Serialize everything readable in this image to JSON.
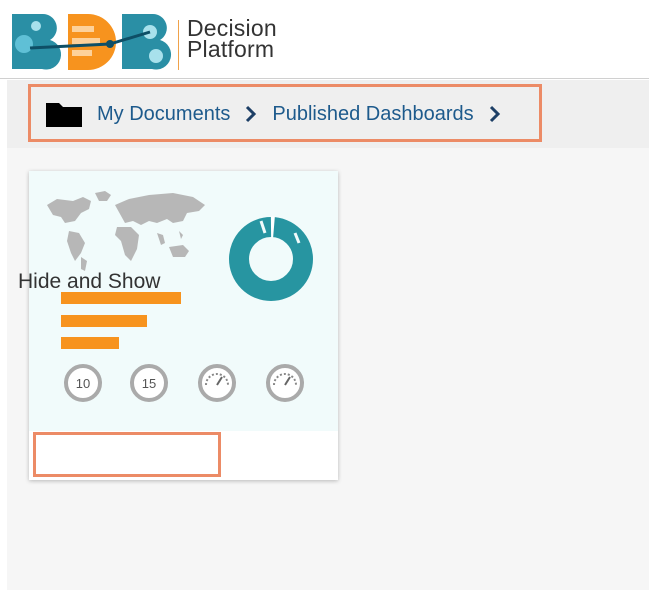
{
  "brand": {
    "logo_letters": "BDB",
    "name_line1": "Decision",
    "name_line2": "Platform"
  },
  "breadcrumb": {
    "items": [
      {
        "label": "My Documents"
      },
      {
        "label": "Published Dashboards"
      }
    ]
  },
  "dashboards": [
    {
      "title": "Hide and Show",
      "thumbnail": {
        "gauge_values": [
          "10",
          "15"
        ]
      }
    }
  ],
  "colors": {
    "accent_teal": "#2795a1",
    "bar_orange": "#f7931e",
    "link_blue": "#1d5a8c",
    "highlight": "#ec8b66"
  }
}
